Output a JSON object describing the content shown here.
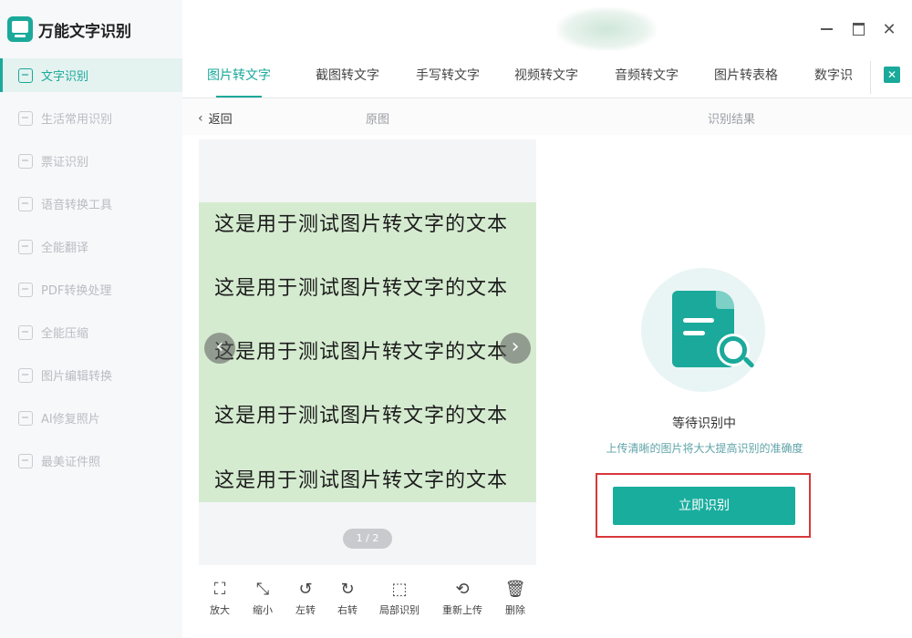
{
  "app": {
    "name": "万能文字识别",
    "brand_color": "#1aa99a",
    "highlight_color": "#d8383b"
  },
  "window_controls": {
    "minimize_icon": "minimize-icon",
    "maximize_icon": "maximize-icon",
    "close_label": "✕"
  },
  "sidebar": {
    "items": [
      {
        "label": "文字识别",
        "icon": "text-scan-icon",
        "active": true
      },
      {
        "label": "生活常用识别",
        "icon": "scan-icon",
        "active": false
      },
      {
        "label": "票证识别",
        "icon": "ticket-icon",
        "active": false
      },
      {
        "label": "语音转换工具",
        "icon": "voice-icon",
        "active": false
      },
      {
        "label": "全能翻译",
        "icon": "translate-icon",
        "active": false
      },
      {
        "label": "PDF转换处理",
        "icon": "pdf-icon",
        "active": false
      },
      {
        "label": "全能压缩",
        "icon": "compress-icon",
        "active": false
      },
      {
        "label": "图片编辑转换",
        "icon": "image-edit-icon",
        "active": false
      },
      {
        "label": "AI修复照片",
        "icon": "ai-photo-icon",
        "active": false
      },
      {
        "label": "最美证件照",
        "icon": "id-photo-icon",
        "active": false
      }
    ]
  },
  "tabs": [
    {
      "label": "图片转文字",
      "active": true
    },
    {
      "label": "截图转文字",
      "active": false
    },
    {
      "label": "手写转文字",
      "active": false
    },
    {
      "label": "视频转文字",
      "active": false
    },
    {
      "label": "音频转文字",
      "active": false
    },
    {
      "label": "图片转表格",
      "active": false
    },
    {
      "label": "数字识",
      "active": false
    }
  ],
  "tabs_more_label": "✕",
  "subheader": {
    "back_label": "返回",
    "original_label": "原图",
    "result_label": "识别结果"
  },
  "preview": {
    "image_lines": [
      "这是用于测试图片转文字的文本",
      "这是用于测试图片转文字的文本",
      "这是用于测试图片转文字的文本",
      "这是用于测试图片转文字的文本",
      "这是用于测试图片转文字的文本"
    ],
    "prev_label": "‹",
    "next_label": "›",
    "pager": "1 / 2"
  },
  "toolbar": [
    {
      "label": "放大",
      "icon": "zoom-in-icon",
      "glyph": "⛶"
    },
    {
      "label": "缩小",
      "icon": "zoom-out-icon",
      "glyph": "⤡"
    },
    {
      "label": "左转",
      "icon": "rotate-left-icon",
      "glyph": "↺"
    },
    {
      "label": "右转",
      "icon": "rotate-right-icon",
      "glyph": "↻"
    },
    {
      "label": "局部识别",
      "icon": "crop-icon",
      "glyph": "⬚"
    },
    {
      "label": "重新上传",
      "icon": "reupload-icon",
      "glyph": "⟲"
    },
    {
      "label": "删除",
      "icon": "delete-icon",
      "glyph": "🗑"
    }
  ],
  "result": {
    "status": "等待识别中",
    "hint": "上传清晰的图片将大大提高识别的准确度",
    "button_label": "立即识别"
  }
}
